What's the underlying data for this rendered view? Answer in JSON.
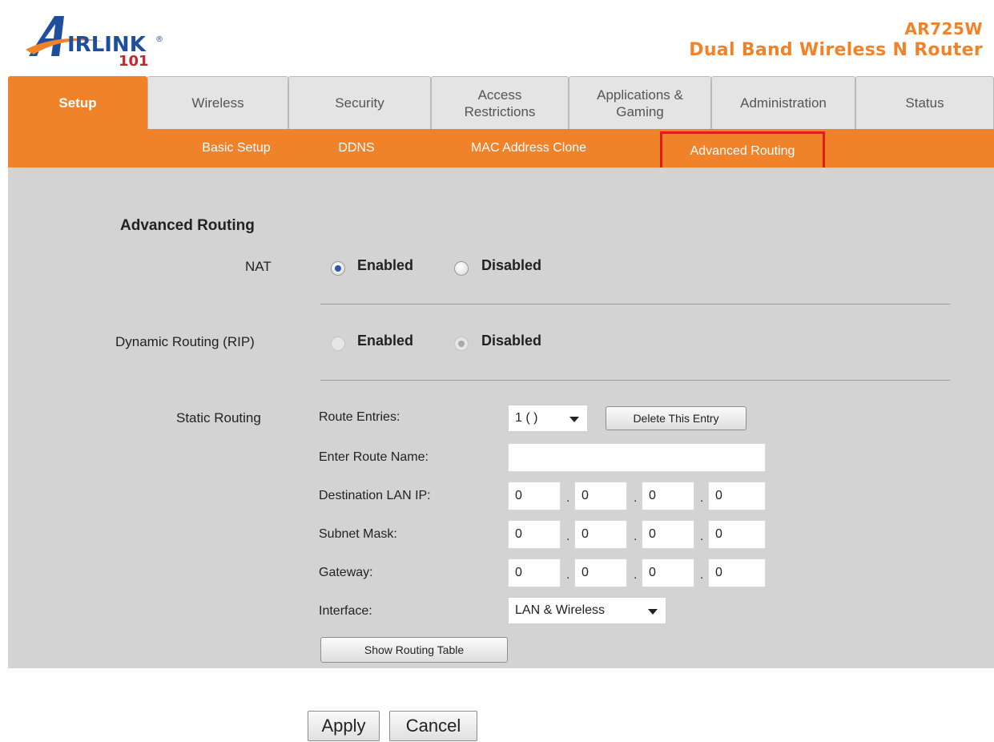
{
  "header": {
    "logo_text": "AIRLINK 101",
    "model": "AR725W",
    "product": "Dual Band Wireless N Router"
  },
  "tabs": [
    {
      "label": "Setup",
      "active": true
    },
    {
      "label": "Wireless",
      "active": false
    },
    {
      "label": "Security",
      "active": false
    },
    {
      "label": "Access Restrictions",
      "active": false
    },
    {
      "label": "Applications & Gaming",
      "active": false
    },
    {
      "label": "Administration",
      "active": false
    },
    {
      "label": "Status",
      "active": false
    }
  ],
  "subnav": [
    {
      "label": "Basic Setup"
    },
    {
      "label": "DDNS"
    },
    {
      "label": "MAC Address Clone"
    },
    {
      "label": "Advanced Routing",
      "highlighted": true
    }
  ],
  "form": {
    "section_title": "Advanced Routing",
    "nat": {
      "label": "NAT",
      "options": [
        "Enabled",
        "Disabled"
      ],
      "selected": "Enabled"
    },
    "rip": {
      "label": "Dynamic Routing (RIP)",
      "options": [
        "Enabled",
        "Disabled"
      ],
      "selected": "Disabled",
      "disabled": true
    },
    "static": {
      "label": "Static Routing",
      "route_entries_label": "Route Entries:",
      "route_entries_value": "1 ( )",
      "delete_button": "Delete This Entry",
      "route_name_label": "Enter Route Name:",
      "route_name_value": "",
      "dest_label": "Destination LAN IP:",
      "dest_ip": [
        "0",
        "0",
        "0",
        "0"
      ],
      "subnet_label": "Subnet Mask:",
      "subnet_ip": [
        "0",
        "0",
        "0",
        "0"
      ],
      "gateway_label": "Gateway:",
      "gateway_ip": [
        "0",
        "0",
        "0",
        "0"
      ],
      "interface_label": "Interface:",
      "interface_value": "LAN & Wireless",
      "show_table_button": "Show Routing Table"
    }
  },
  "footer": {
    "apply": "Apply",
    "cancel": "Cancel"
  },
  "colors": {
    "accent": "#f0822a",
    "highlight_box": "#e01c1c",
    "panel": "#d3d3d3"
  }
}
